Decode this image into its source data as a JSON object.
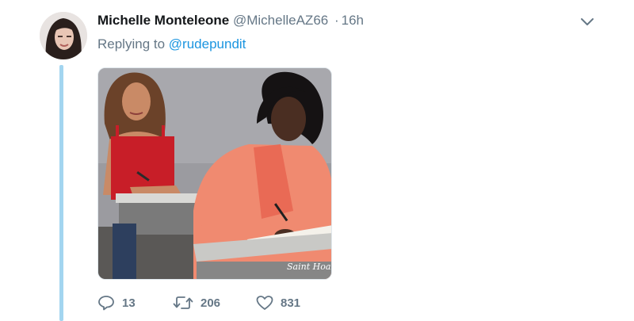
{
  "tweet": {
    "author_name": "Michelle Monteleone",
    "handle": "@MichelleAZ66",
    "separator": "·",
    "time": "16h",
    "replying_prefix": "Replying to",
    "reply_mention": "@rudepundit",
    "image_watermark": "Saint Hoax"
  },
  "actions": {
    "reply_count": "13",
    "retweet_count": "206",
    "like_count": "831"
  },
  "icons": {
    "reply": "reply-icon",
    "retweet": "retweet-icon",
    "like": "heart-icon",
    "menu": "chevron-down-icon"
  },
  "colors": {
    "thread_line": "#a3d5f0",
    "link": "#1b95e0",
    "muted": "#657786",
    "name": "#14171a"
  }
}
